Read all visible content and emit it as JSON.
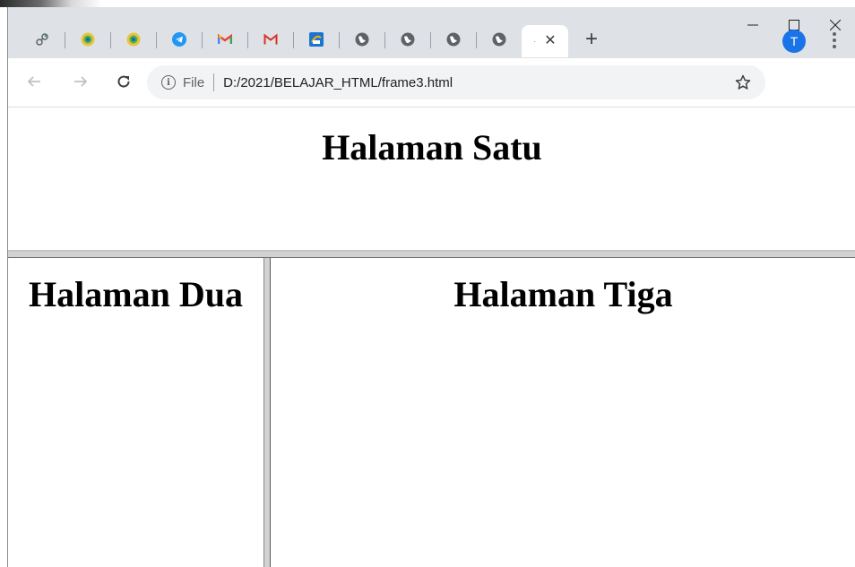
{
  "browser": {
    "tabs": [
      {
        "icon": "link-icon"
      },
      {
        "icon": "university-seal-icon"
      },
      {
        "icon": "university-seal-icon"
      },
      {
        "icon": "telegram-icon"
      },
      {
        "icon": "gmail-icon"
      },
      {
        "icon": "gmail-icon"
      },
      {
        "icon": "app-icon"
      },
      {
        "icon": "globe-icon"
      },
      {
        "icon": "globe-icon"
      },
      {
        "icon": "globe-icon"
      },
      {
        "icon": "globe-icon"
      }
    ],
    "active_tab": {
      "close_icon": "close-icon"
    },
    "new_tab_label": "+",
    "window_controls": {
      "minimize": "—",
      "maximize": "☐",
      "close": "✕"
    },
    "omnibox": {
      "scheme_label": "File",
      "url": "D:/2021/BELAJAR_HTML/frame3.html"
    },
    "profile_initial": "T",
    "accent_color": "#1a73e8"
  },
  "frames": {
    "top": {
      "heading": "Halaman Satu"
    },
    "left": {
      "heading": "Halaman Dua"
    },
    "right": {
      "heading": "Halaman Tiga"
    }
  }
}
